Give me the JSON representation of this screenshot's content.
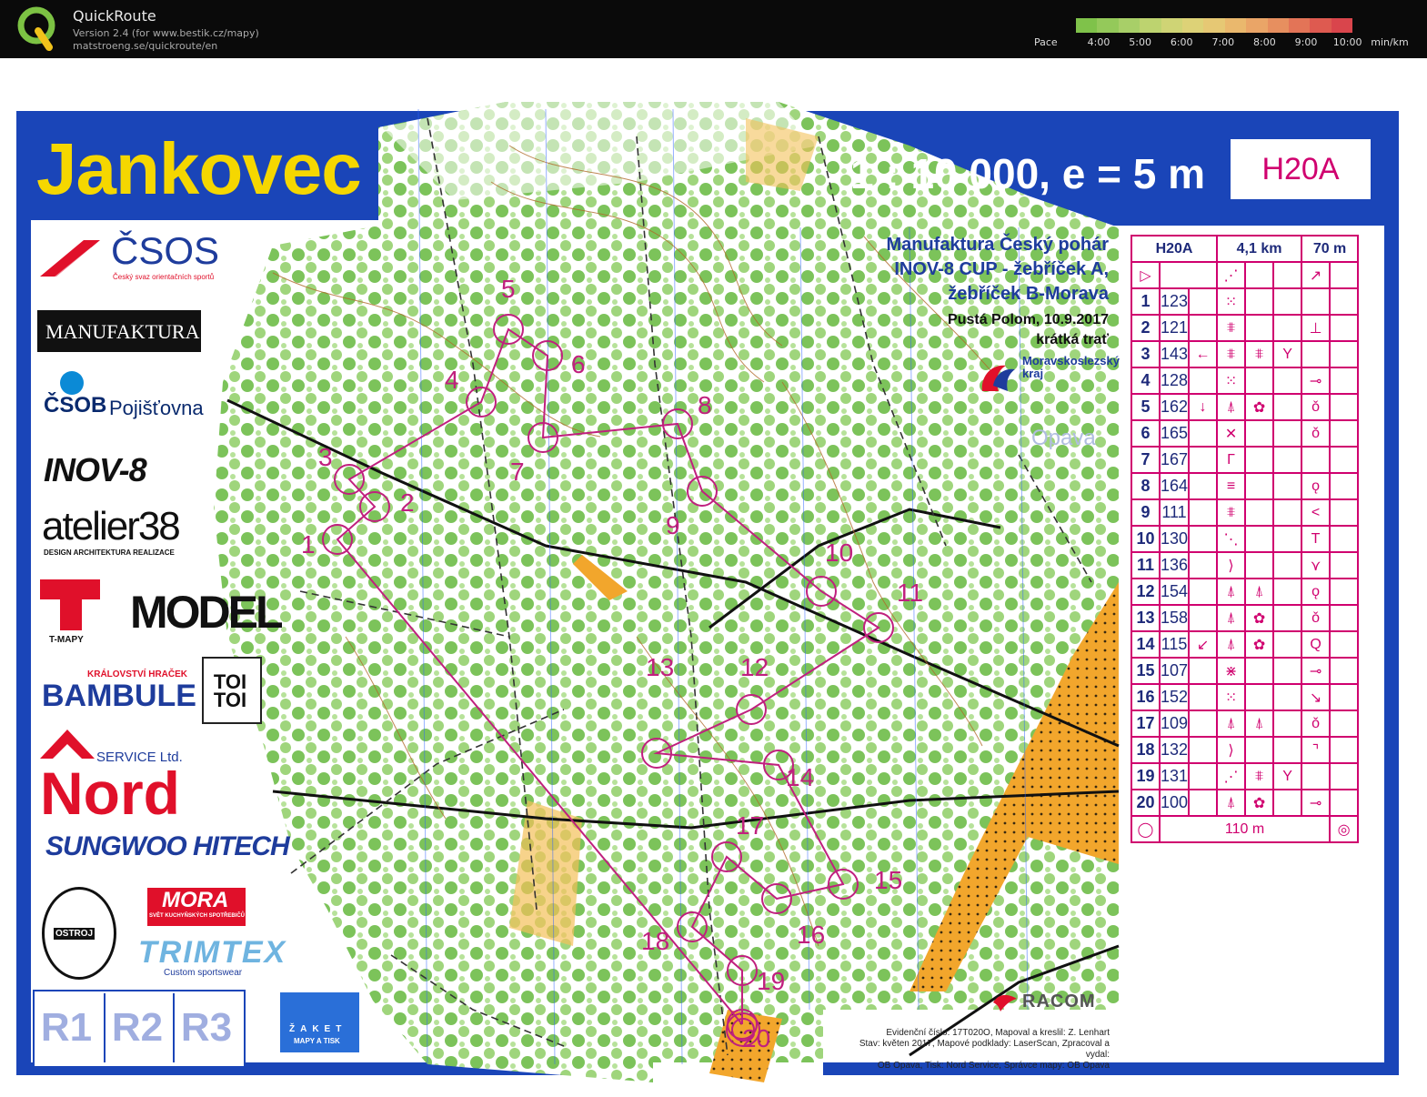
{
  "app": {
    "title": "QuickRoute",
    "version_line": "Version 2.4  (for www.bestik.cz/mapy)",
    "site_line": "matstroeng.se/quickroute/en",
    "logo_icon": "quickroute-q-icon"
  },
  "pace": {
    "label": "Pace",
    "ticks": [
      "4:00",
      "5:00",
      "6:00",
      "7:00",
      "8:00",
      "9:00",
      "10:00"
    ],
    "unit": "min/km",
    "colors": [
      "#7fc24a",
      "#94c95a",
      "#a8cf68",
      "#bdd36f",
      "#cfd475",
      "#ddd277",
      "#e6c874",
      "#eab86d",
      "#eaa567",
      "#e78f5f",
      "#e37457",
      "#de5a50",
      "#d9454c"
    ]
  },
  "map": {
    "name": "Jankovec",
    "scale": "1 : 10 000,  e = 5 m",
    "class": "H20A",
    "event": {
      "line1": "Manufaktura Český pohár",
      "line2": "INOV-8 CUP - žebříček A,",
      "line3": "žebříček B-Morava",
      "place_date": "Pustá Polom, 10.9.2017",
      "format": "krátká trať"
    },
    "region": "Moravskoslezský kraj",
    "city": "Opava",
    "racom": "RACOM",
    "credits": [
      "Evidenční číslo: 17T020O, Mapoval a kreslil: Z. Lenhart",
      "Stav: květen 2017, Mapové podklady: LaserScan, Zpracoval a vydal:",
      "OB Opava, Tisk: Nord Service, Správce mapy: OB Opava"
    ],
    "r_boxes": [
      "R1",
      "R2",
      "R3"
    ],
    "colors": {
      "frame_blue": "#1a45b8",
      "title_yellow": "#f5d700",
      "course_magenta": "#c0207e",
      "forest_green": "#8ccf6a",
      "open_yellow": "#f4c15a",
      "orange": "#f0a020"
    }
  },
  "sponsors": {
    "csos": "ČSOS",
    "csos_sub": "Český svaz orientačních sportů",
    "manufaktura": "MANUFAKTURA",
    "csob": "ČSOB",
    "csob_sub": "Pojišťovna",
    "inov8": "INOV-8",
    "atelier": "atelier38",
    "atelier_sub": "DESIGN ARCHITEKTURA REALIZACE",
    "tmapy": "T-MAPY",
    "model": "MODEL",
    "bambule_top": "KRÁLOVSTVÍ HRAČEK",
    "bambule": "BAMBULE",
    "toitoi": "TOI TOI",
    "nord_top": "SERVICE Ltd.",
    "nord": "Nord",
    "sungwoo": "SUNGWOO HITECH",
    "mora": "MORA",
    "mora_sub": "SVĚT KUCHYŇSKÝCH SPOTŘEBIČŮ",
    "ostroj": "OSTROJ",
    "trimtex": "TRIMTEX",
    "trimtex_sub": "Custom sportswear",
    "zaket": "ŽAKET",
    "zaket_sub": "MAPY A TISK"
  },
  "control_descriptions": {
    "header": {
      "class": "H20A",
      "length": "4,1 km",
      "climb": "70 m"
    },
    "rows": [
      {
        "n": "1",
        "code": "123",
        "c": "",
        "d": "⁙",
        "e": "",
        "f": "",
        "g": "",
        "h": ""
      },
      {
        "n": "2",
        "code": "121",
        "c": "",
        "d": "⩨",
        "e": "",
        "f": "",
        "g": "⊥",
        "h": ""
      },
      {
        "n": "3",
        "code": "143",
        "c": "←",
        "d": "⩨",
        "e": "⩨",
        "f": "Y",
        "g": "",
        "h": ""
      },
      {
        "n": "4",
        "code": "128",
        "c": "",
        "d": "⁙",
        "e": "",
        "f": "",
        "g": "⊸",
        "h": ""
      },
      {
        "n": "5",
        "code": "162",
        "c": "↓",
        "d": "⍋",
        "e": "✿",
        "f": "",
        "g": "ǒ",
        "h": ""
      },
      {
        "n": "6",
        "code": "165",
        "c": "",
        "d": "✕",
        "e": "",
        "f": "",
        "g": "ǒ",
        "h": ""
      },
      {
        "n": "7",
        "code": "167",
        "c": "",
        "d": "Γ",
        "e": "",
        "f": "",
        "g": "",
        "h": ""
      },
      {
        "n": "8",
        "code": "164",
        "c": "",
        "d": "≡",
        "e": "",
        "f": "",
        "g": "ǫ",
        "h": ""
      },
      {
        "n": "9",
        "code": "111",
        "c": "",
        "d": "⩨",
        "e": "",
        "f": "",
        "g": "<",
        "h": ""
      },
      {
        "n": "10",
        "code": "130",
        "c": "",
        "d": "⋱",
        "e": "",
        "f": "",
        "g": "T",
        "h": ""
      },
      {
        "n": "11",
        "code": "136",
        "c": "",
        "d": "⟩",
        "e": "",
        "f": "",
        "g": "⋎",
        "h": ""
      },
      {
        "n": "12",
        "code": "154",
        "c": "",
        "d": "⍋",
        "e": "⍋",
        "f": "",
        "g": "ǫ",
        "h": ""
      },
      {
        "n": "13",
        "code": "158",
        "c": "",
        "d": "⍋",
        "e": "✿",
        "f": "",
        "g": "ǒ",
        "h": ""
      },
      {
        "n": "14",
        "code": "115",
        "c": "↙",
        "d": "⍋",
        "e": "✿",
        "f": "",
        "g": "Q",
        "h": ""
      },
      {
        "n": "15",
        "code": "107",
        "c": "",
        "d": "⋇",
        "e": "",
        "f": "",
        "g": "⊸",
        "h": ""
      },
      {
        "n": "16",
        "code": "152",
        "c": "",
        "d": "⁙",
        "e": "",
        "f": "",
        "g": "↘",
        "h": ""
      },
      {
        "n": "17",
        "code": "109",
        "c": "",
        "d": "⍋",
        "e": "⍋",
        "f": "",
        "g": "ǒ",
        "h": ""
      },
      {
        "n": "18",
        "code": "132",
        "c": "",
        "d": "⟩",
        "e": "",
        "f": "",
        "g": "⌝",
        "h": ""
      },
      {
        "n": "19",
        "code": "131",
        "c": "",
        "d": "⋰",
        "e": "⩨",
        "f": "Y",
        "g": "",
        "h": ""
      },
      {
        "n": "20",
        "code": "100",
        "c": "",
        "d": "⍋",
        "e": "✿",
        "f": "",
        "g": "⊸",
        "h": ""
      }
    ],
    "finish_distance": "110 m"
  },
  "course": {
    "control_labels": [
      "1",
      "2",
      "3",
      "4",
      "5",
      "6",
      "7",
      "8",
      "9",
      "10",
      "11",
      "12",
      "13",
      "14",
      "15",
      "16",
      "17",
      "18",
      "19",
      "20"
    ]
  }
}
